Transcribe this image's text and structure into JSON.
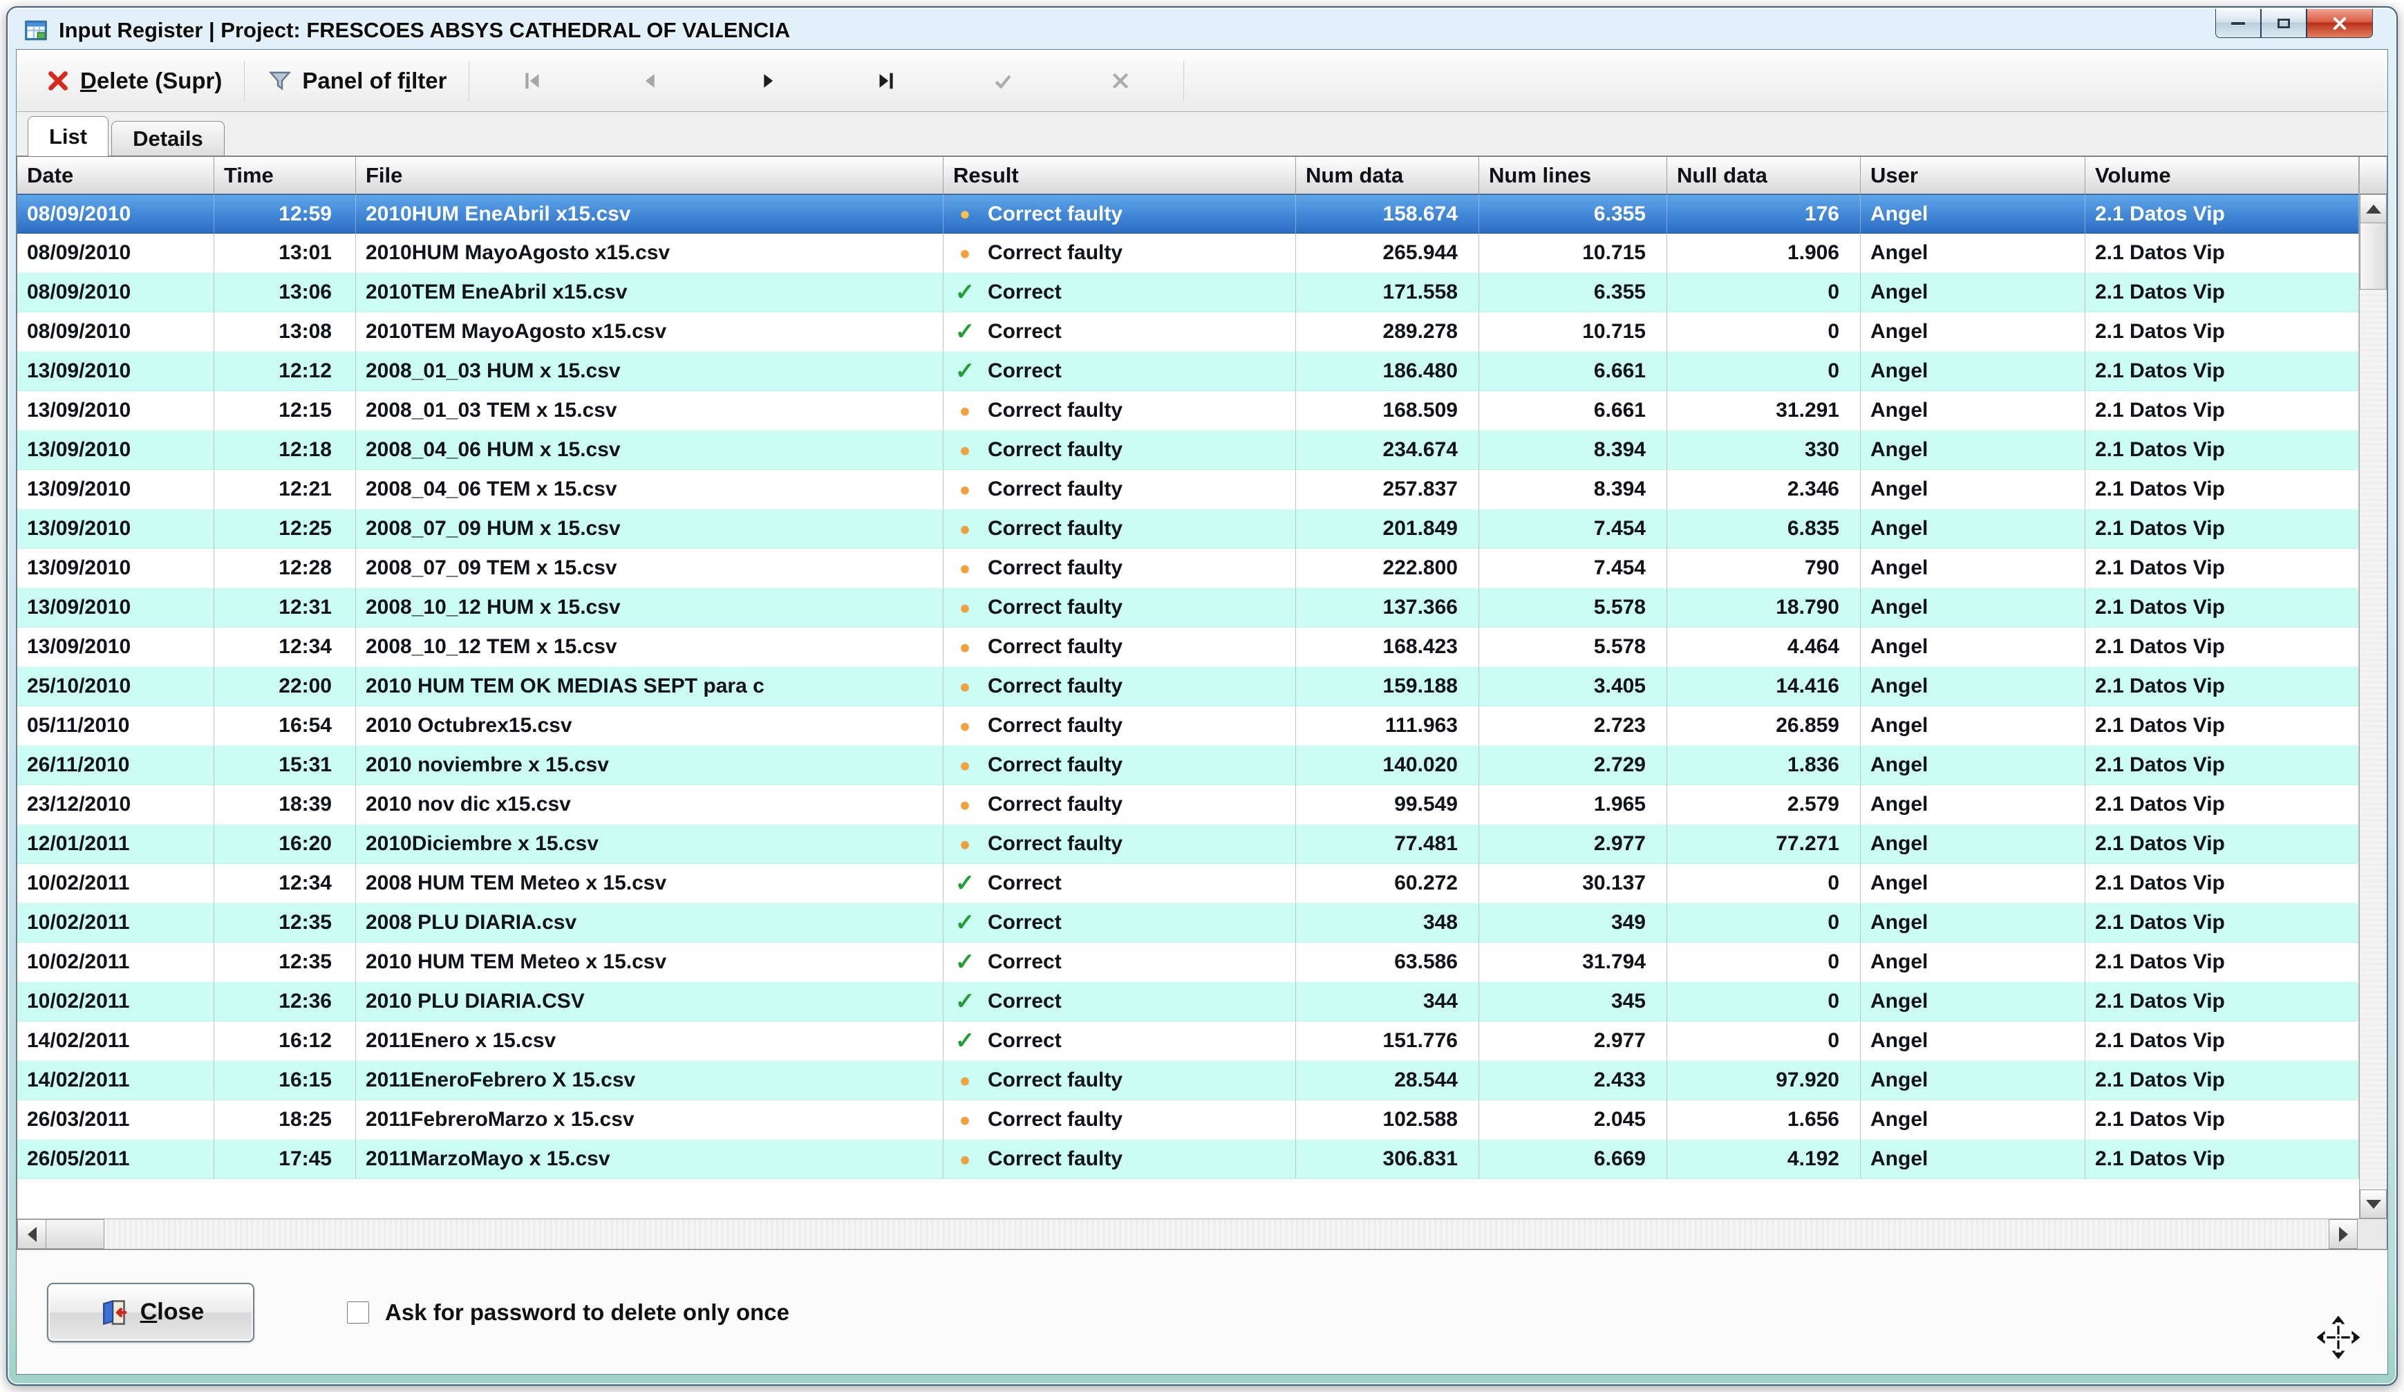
{
  "window": {
    "title": "Input Register | Project: FRESCOES ABSYS CATHEDRAL OF VALENCIA"
  },
  "colors": {
    "row_stripe": "#ccfdf4",
    "selected_row_top": "#5ea6ea",
    "selected_row_bottom": "#2a6cc4",
    "status_ok": "#1f9e35",
    "status_warn": "#f2a03a",
    "close_button_red": "#ba2f1d"
  },
  "toolbar": {
    "delete_button": {
      "accel": "D",
      "rest": "elete (Supr)"
    },
    "filter_button": {
      "pre": "Panel of f",
      "accel": "i",
      "rest": "lter"
    },
    "nav": [
      {
        "name": "first",
        "enabled": false
      },
      {
        "name": "prior",
        "enabled": false
      },
      {
        "name": "next",
        "enabled": true
      },
      {
        "name": "last",
        "enabled": true
      },
      {
        "name": "edit",
        "enabled": false
      },
      {
        "name": "cancel",
        "enabled": false
      }
    ]
  },
  "tabs": [
    {
      "label": "List",
      "active": true
    },
    {
      "label": "Details",
      "active": false
    }
  ],
  "grid": {
    "columns": [
      {
        "key": "date",
        "label": "Date"
      },
      {
        "key": "time",
        "label": "Time"
      },
      {
        "key": "file",
        "label": "File"
      },
      {
        "key": "result",
        "label": "Result"
      },
      {
        "key": "num_data",
        "label": "Num data"
      },
      {
        "key": "num_lines",
        "label": "Num lines"
      },
      {
        "key": "null_data",
        "label": "Null data"
      },
      {
        "key": "user",
        "label": "User"
      },
      {
        "key": "volume",
        "label": "Volume"
      }
    ],
    "status_icons": {
      "ok": "✓",
      "warn": "●"
    },
    "rows": [
      {
        "date": "08/09/2010",
        "time": "12:59",
        "file": "2010HUM EneAbril x15.csv",
        "result": "Correct faulty",
        "status": "warn",
        "num_data": "158.674",
        "num_lines": "6.355",
        "null_data": "176",
        "user": "Angel",
        "volume": "2.1 Datos Vip",
        "selected": true
      },
      {
        "date": "08/09/2010",
        "time": "13:01",
        "file": "2010HUM MayoAgosto x15.csv",
        "result": "Correct faulty",
        "status": "warn",
        "num_data": "265.944",
        "num_lines": "10.715",
        "null_data": "1.906",
        "user": "Angel",
        "volume": "2.1 Datos Vip"
      },
      {
        "date": "08/09/2010",
        "time": "13:06",
        "file": "2010TEM EneAbril x15.csv",
        "result": "Correct",
        "status": "ok",
        "num_data": "171.558",
        "num_lines": "6.355",
        "null_data": "0",
        "user": "Angel",
        "volume": "2.1 Datos Vip"
      },
      {
        "date": "08/09/2010",
        "time": "13:08",
        "file": "2010TEM MayoAgosto x15.csv",
        "result": "Correct",
        "status": "ok",
        "num_data": "289.278",
        "num_lines": "10.715",
        "null_data": "0",
        "user": "Angel",
        "volume": "2.1 Datos Vip"
      },
      {
        "date": "13/09/2010",
        "time": "12:12",
        "file": "2008_01_03 HUM x 15.csv",
        "result": "Correct",
        "status": "ok",
        "num_data": "186.480",
        "num_lines": "6.661",
        "null_data": "0",
        "user": "Angel",
        "volume": "2.1 Datos Vip"
      },
      {
        "date": "13/09/2010",
        "time": "12:15",
        "file": "2008_01_03 TEM x 15.csv",
        "result": "Correct faulty",
        "status": "warn",
        "num_data": "168.509",
        "num_lines": "6.661",
        "null_data": "31.291",
        "user": "Angel",
        "volume": "2.1 Datos Vip"
      },
      {
        "date": "13/09/2010",
        "time": "12:18",
        "file": "2008_04_06 HUM x 15.csv",
        "result": "Correct faulty",
        "status": "warn",
        "num_data": "234.674",
        "num_lines": "8.394",
        "null_data": "330",
        "user": "Angel",
        "volume": "2.1 Datos Vip"
      },
      {
        "date": "13/09/2010",
        "time": "12:21",
        "file": "2008_04_06 TEM x 15.csv",
        "result": "Correct faulty",
        "status": "warn",
        "num_data": "257.837",
        "num_lines": "8.394",
        "null_data": "2.346",
        "user": "Angel",
        "volume": "2.1 Datos Vip"
      },
      {
        "date": "13/09/2010",
        "time": "12:25",
        "file": "2008_07_09 HUM x 15.csv",
        "result": "Correct faulty",
        "status": "warn",
        "num_data": "201.849",
        "num_lines": "7.454",
        "null_data": "6.835",
        "user": "Angel",
        "volume": "2.1 Datos Vip"
      },
      {
        "date": "13/09/2010",
        "time": "12:28",
        "file": "2008_07_09 TEM x 15.csv",
        "result": "Correct faulty",
        "status": "warn",
        "num_data": "222.800",
        "num_lines": "7.454",
        "null_data": "790",
        "user": "Angel",
        "volume": "2.1 Datos Vip"
      },
      {
        "date": "13/09/2010",
        "time": "12:31",
        "file": "2008_10_12 HUM x 15.csv",
        "result": "Correct faulty",
        "status": "warn",
        "num_data": "137.366",
        "num_lines": "5.578",
        "null_data": "18.790",
        "user": "Angel",
        "volume": "2.1 Datos Vip"
      },
      {
        "date": "13/09/2010",
        "time": "12:34",
        "file": "2008_10_12 TEM x 15.csv",
        "result": "Correct faulty",
        "status": "warn",
        "num_data": "168.423",
        "num_lines": "5.578",
        "null_data": "4.464",
        "user": "Angel",
        "volume": "2.1 Datos Vip"
      },
      {
        "date": "25/10/2010",
        "time": "22:00",
        "file": "2010 HUM TEM OK MEDIAS SEPT para c",
        "result": "Correct faulty",
        "status": "warn",
        "num_data": "159.188",
        "num_lines": "3.405",
        "null_data": "14.416",
        "user": "Angel",
        "volume": "2.1 Datos Vip"
      },
      {
        "date": "05/11/2010",
        "time": "16:54",
        "file": "2010 Octubrex15.csv",
        "result": "Correct faulty",
        "status": "warn",
        "num_data": "111.963",
        "num_lines": "2.723",
        "null_data": "26.859",
        "user": "Angel",
        "volume": "2.1 Datos Vip"
      },
      {
        "date": "26/11/2010",
        "time": "15:31",
        "file": "2010 noviembre x 15.csv",
        "result": "Correct faulty",
        "status": "warn",
        "num_data": "140.020",
        "num_lines": "2.729",
        "null_data": "1.836",
        "user": "Angel",
        "volume": "2.1 Datos Vip"
      },
      {
        "date": "23/12/2010",
        "time": "18:39",
        "file": "2010 nov dic x15.csv",
        "result": "Correct faulty",
        "status": "warn",
        "num_data": "99.549",
        "num_lines": "1.965",
        "null_data": "2.579",
        "user": "Angel",
        "volume": "2.1 Datos Vip"
      },
      {
        "date": "12/01/2011",
        "time": "16:20",
        "file": "2010Diciembre x 15.csv",
        "result": "Correct faulty",
        "status": "warn",
        "num_data": "77.481",
        "num_lines": "2.977",
        "null_data": "77.271",
        "user": "Angel",
        "volume": "2.1 Datos Vip"
      },
      {
        "date": "10/02/2011",
        "time": "12:34",
        "file": "2008 HUM TEM Meteo x 15.csv",
        "result": "Correct",
        "status": "ok",
        "num_data": "60.272",
        "num_lines": "30.137",
        "null_data": "0",
        "user": "Angel",
        "volume": "2.1 Datos Vip"
      },
      {
        "date": "10/02/2011",
        "time": "12:35",
        "file": "2008 PLU DIARIA.csv",
        "result": "Correct",
        "status": "ok",
        "num_data": "348",
        "num_lines": "349",
        "null_data": "0",
        "user": "Angel",
        "volume": "2.1 Datos Vip"
      },
      {
        "date": "10/02/2011",
        "time": "12:35",
        "file": "2010 HUM TEM Meteo x 15.csv",
        "result": "Correct",
        "status": "ok",
        "num_data": "63.586",
        "num_lines": "31.794",
        "null_data": "0",
        "user": "Angel",
        "volume": "2.1 Datos Vip"
      },
      {
        "date": "10/02/2011",
        "time": "12:36",
        "file": "2010 PLU DIARIA.CSV",
        "result": "Correct",
        "status": "ok",
        "num_data": "344",
        "num_lines": "345",
        "null_data": "0",
        "user": "Angel",
        "volume": "2.1 Datos Vip"
      },
      {
        "date": "14/02/2011",
        "time": "16:12",
        "file": "2011Enero x 15.csv",
        "result": "Correct",
        "status": "ok",
        "num_data": "151.776",
        "num_lines": "2.977",
        "null_data": "0",
        "user": "Angel",
        "volume": "2.1 Datos Vip"
      },
      {
        "date": "14/02/2011",
        "time": "16:15",
        "file": "2011EneroFebrero X 15.csv",
        "result": "Correct faulty",
        "status": "warn",
        "num_data": "28.544",
        "num_lines": "2.433",
        "null_data": "97.920",
        "user": "Angel",
        "volume": "2.1 Datos Vip"
      },
      {
        "date": "26/03/2011",
        "time": "18:25",
        "file": "2011FebreroMarzo x 15.csv",
        "result": "Correct faulty",
        "status": "warn",
        "num_data": "102.588",
        "num_lines": "2.045",
        "null_data": "1.656",
        "user": "Angel",
        "volume": "2.1 Datos Vip"
      },
      {
        "date": "26/05/2011",
        "time": "17:45",
        "file": "2011MarzoMayo x 15.csv",
        "result": "Correct faulty",
        "status": "warn",
        "num_data": "306.831",
        "num_lines": "6.669",
        "null_data": "4.192",
        "user": "Angel",
        "volume": "2.1 Datos Vip"
      }
    ]
  },
  "footer": {
    "close_button": {
      "accel": "C",
      "rest": "lose"
    },
    "checkbox": {
      "label": "Ask for password to delete only once",
      "checked": false
    }
  }
}
